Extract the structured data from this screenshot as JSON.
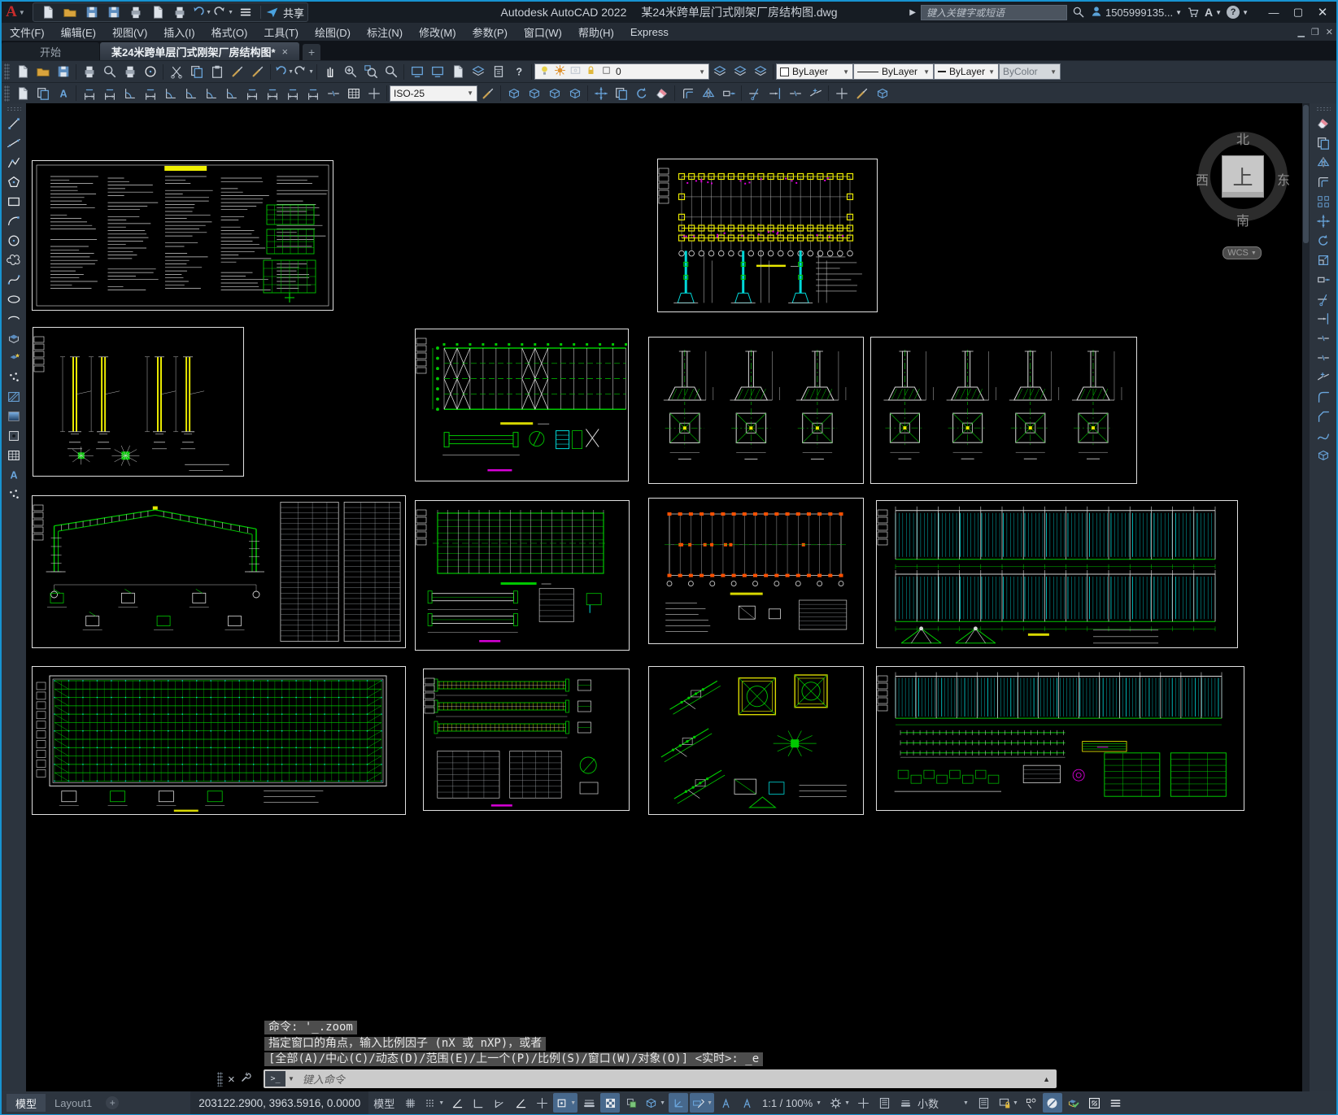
{
  "title_bar": {
    "app_title": "Autodesk AutoCAD 2022",
    "doc_title": "某24米跨单层门式刚架厂房结构图.dwg",
    "search_placeholder": "键入关键字或短语",
    "user_id": "1505999135...",
    "share_label": "共享",
    "quick_access_icons": [
      "qnew",
      "qopen",
      "qsave",
      "qsave-as",
      "qplot",
      "qtransfer",
      "qprint",
      "qundo",
      "qredo",
      "qat-more"
    ],
    "window_buttons": [
      "minimize",
      "maximize",
      "close"
    ]
  },
  "menu_bar": {
    "items": [
      {
        "id": "file",
        "label": "文件(F)"
      },
      {
        "id": "edit",
        "label": "编辑(E)"
      },
      {
        "id": "view",
        "label": "视图(V)"
      },
      {
        "id": "insert",
        "label": "插入(I)"
      },
      {
        "id": "format",
        "label": "格式(O)"
      },
      {
        "id": "tools",
        "label": "工具(T)"
      },
      {
        "id": "draw",
        "label": "绘图(D)"
      },
      {
        "id": "dimension",
        "label": "标注(N)"
      },
      {
        "id": "modify",
        "label": "修改(M)"
      },
      {
        "id": "parametric",
        "label": "参数(P)"
      },
      {
        "id": "window",
        "label": "窗口(W)"
      },
      {
        "id": "help",
        "label": "帮助(H)"
      },
      {
        "id": "express",
        "label": "Express"
      }
    ]
  },
  "file_tabs": {
    "start_tab": "开始",
    "active_tab": "某24米跨单层门式刚架厂房结构图*",
    "close_glyph": "×",
    "new_tab_glyph": "+"
  },
  "toolbar_row1": {
    "icons_left": [
      "new",
      "open",
      "save",
      "plot",
      "print-preview",
      "publish",
      "web",
      "cut",
      "copy-clip",
      "paste",
      "match-properties",
      "match-block",
      "undo",
      "redo",
      "pan",
      "zoom-realtime",
      "zoom-window",
      "zoom-previous",
      "viewports",
      "named-views",
      "sheet-set",
      "tool-palettes",
      "quick-calc",
      "help"
    ],
    "layer_combo": {
      "current_layer": "0",
      "icons": [
        "bulb",
        "sun",
        "viewport-freeze",
        "lock",
        "swatch"
      ]
    },
    "layer_tool_icons": [
      "make-object-layer-current",
      "layer-previous",
      "layer-match"
    ],
    "color_combo": "ByLayer",
    "linetype_combo": "ByLayer",
    "lineweight_combo": "ByLayer",
    "plotstyle_combo": "ByColor"
  },
  "toolbar_row2": {
    "icons_left": [
      "edit-block",
      "edit-reference",
      "edit-attribute",
      "dim-linear",
      "dim-aligned",
      "dim-arc-length",
      "dim-ordinate",
      "dim-radius",
      "dim-jogged",
      "dim-diameter",
      "dim-angular",
      "dim-quick",
      "dim-baseline",
      "dim-continue",
      "dim-space",
      "dim-break",
      "dim-tolerance",
      "dim-center-mark"
    ],
    "dim_style_combo": "ISO-25",
    "dim_update_icon": "dim-update",
    "icons_right": [
      "union",
      "subtract",
      "intersect",
      "explode",
      "move",
      "copy",
      "rotate",
      "delete",
      "offset",
      "mirror",
      "stretch",
      "trim",
      "extend",
      "break",
      "join",
      "add-selected",
      "brush",
      "separate"
    ]
  },
  "draw_rail_icons": [
    "line",
    "construction-line",
    "polyline",
    "polygon",
    "rectangle",
    "arc",
    "circle",
    "revision-cloud",
    "spline",
    "ellipse",
    "ellipse-arc",
    "insert-block",
    "create-block",
    "multiple-points",
    "hatch",
    "gradient",
    "region",
    "table",
    "multiline-text",
    "point-style"
  ],
  "modify_rail_icons": [
    "erase",
    "copy",
    "mirror",
    "offset",
    "array",
    "move",
    "rotate",
    "scale",
    "stretch",
    "trim",
    "extend",
    "break-at-point",
    "break",
    "join",
    "fillet",
    "chamfer",
    "blend-curves",
    "box"
  ],
  "viewcube": {
    "north": "北",
    "south": "南",
    "west": "西",
    "east": "东",
    "top": "上",
    "wcs": "WCS"
  },
  "command_line": {
    "history": [
      "命令: '_.zoom",
      "指定窗口的角点，输入比例因子 (nX 或 nXP)，或者",
      "[全部(A)/中心(C)/动态(D)/范围(E)/上一个(P)/比例(S)/窗口(W)/对象(O)] <实时>: _e"
    ],
    "prompt_placeholder": "键入命令",
    "close_glyph": "×"
  },
  "layout_tabs": {
    "model": "模型",
    "layout1": "Layout1",
    "add_glyph": "+"
  },
  "status_bar": {
    "coordinates": "203122.2900, 3963.5916, 0.0000",
    "model_label": "模型",
    "icons_left": [
      "grid-display",
      "snap-mode"
    ],
    "icons_mid": [
      "infer-constraints",
      "ortho-mode",
      "polar-tracking",
      "isometric-drafting",
      "object-snap-tracking",
      "object-snap",
      "lineweight-display",
      "transparency",
      "selection-cycling",
      "osnap-3d",
      "dynamic-ucs",
      "dynamic-input",
      "annotation-visibility",
      "annotation-autoscale"
    ],
    "scale_label": "1:1 / 100%",
    "icons_right1": [
      "workspace-switching",
      "crosshair-tooltip",
      "annotation-monitor"
    ],
    "units_label": "小数",
    "icons_right2": [
      "quick-properties",
      "lock-ui",
      "isolate-objects",
      "hardware-acceleration",
      "graphics-performance",
      "clean-screen",
      "customization"
    ],
    "highlighted": [
      "object-snap",
      "transparency",
      "dynamic-ucs",
      "dynamic-input",
      "hardware-acceleration"
    ]
  },
  "colors": {
    "accent_blue": "#1793d1",
    "cad_green": "#00c800",
    "cad_yellow": "#e8e800",
    "cad_cyan": "#00d8d8",
    "cad_magenta": "#d800d8",
    "cad_orange": "#ff5000"
  }
}
